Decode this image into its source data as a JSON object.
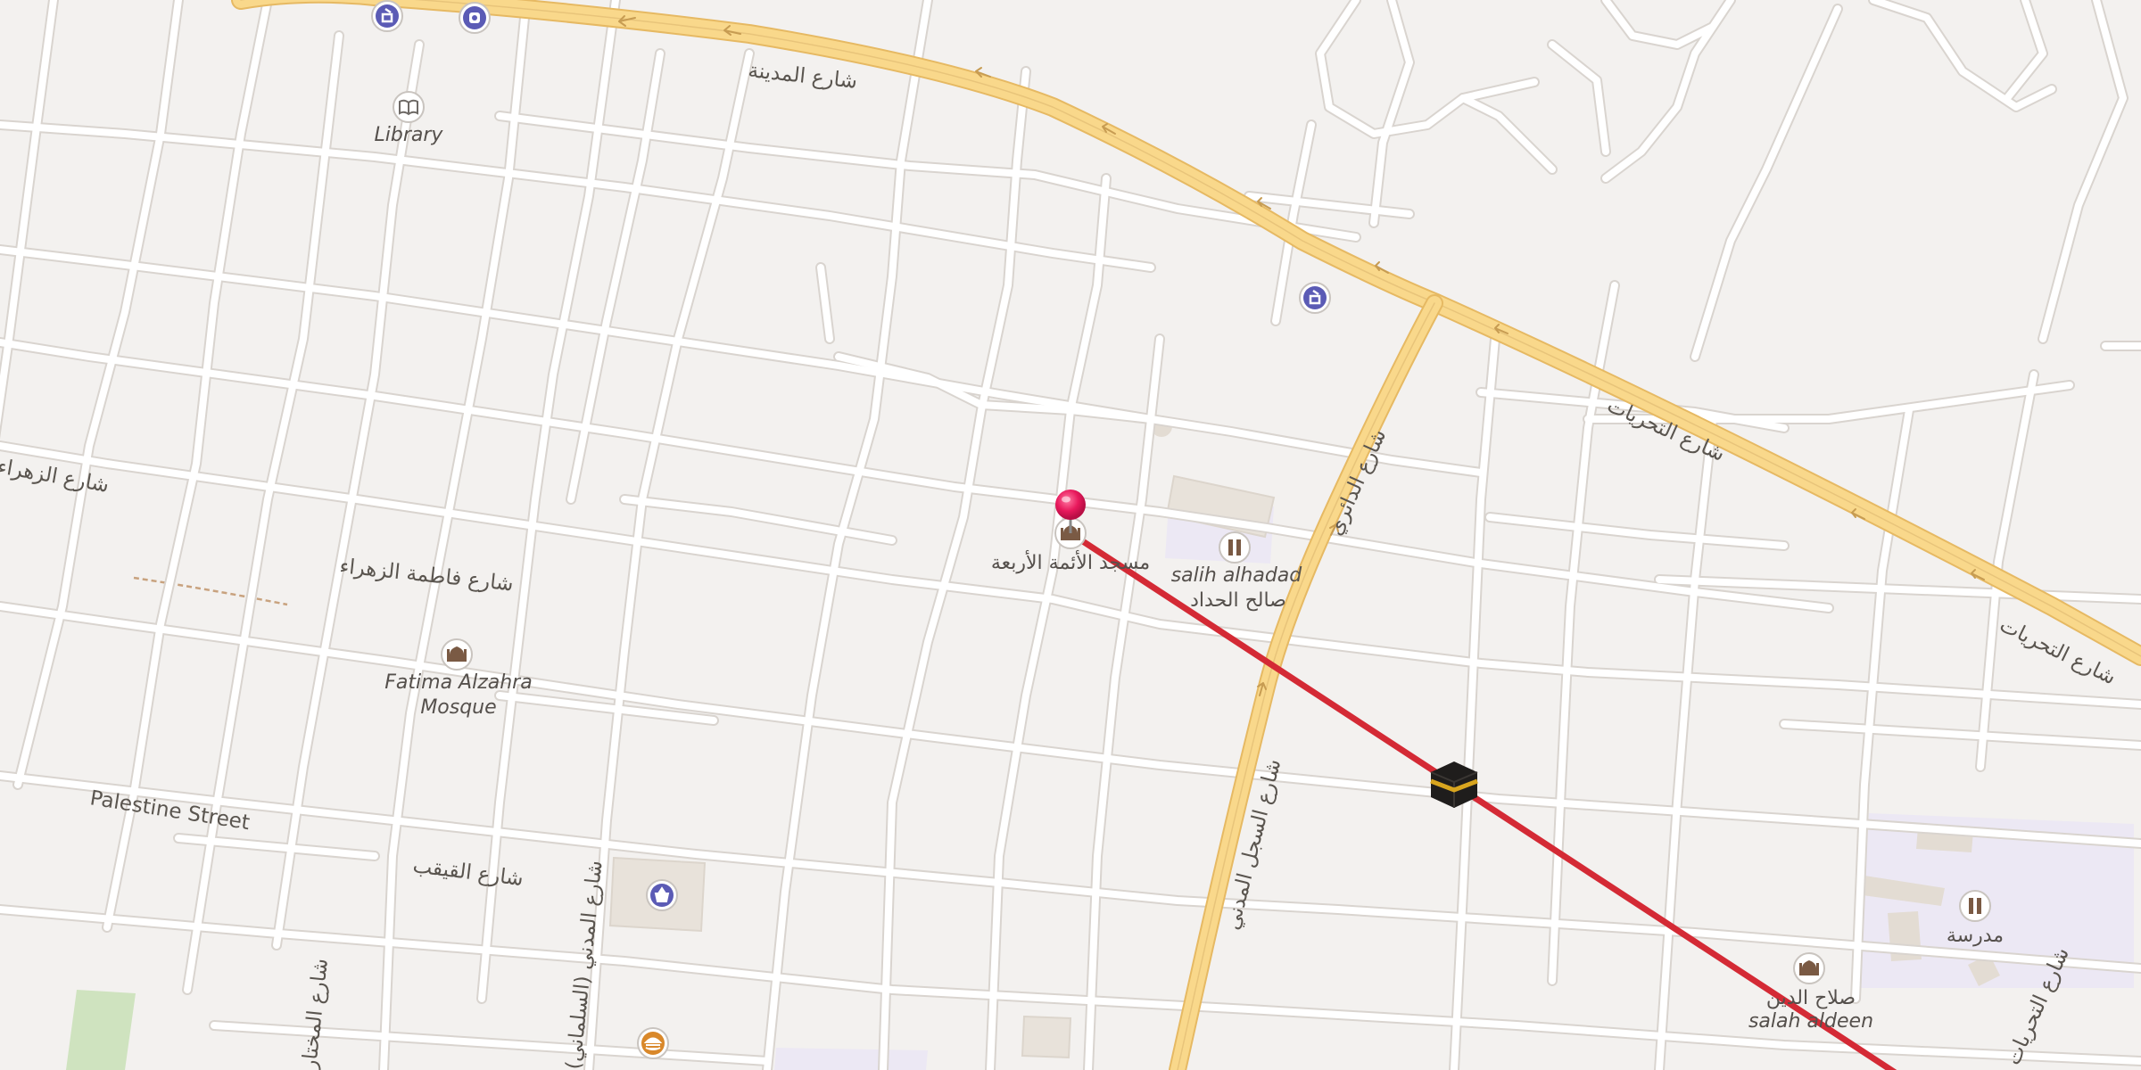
{
  "map": {
    "colors": {
      "background": "#f3f1ef",
      "minor_road": "#ffffff",
      "road_casing": "#d9d4cf",
      "major_road": "#f9d88b",
      "major_casing": "#e6b963",
      "route_line": "#d42a35",
      "pin": "#e8195c",
      "poi_blue": "#5b5bb5",
      "poi_brown": "#7a5a44",
      "campus": "#ece8f4",
      "building": "#e8e2da",
      "park": "#cfe3bf",
      "footpath": "#c8a27e"
    },
    "streets": {
      "al_madina_top": "شارع المدينة",
      "al_madina_north": "شارع الدائري",
      "tahrir_1": "شارع التحريات",
      "tahrir_2": "شارع التحريات",
      "fatima_zahraa": "شارع فاطمة الزهراء",
      "zahraa_left": "شارع الزهراء",
      "palestine": "Palestine Street",
      "qeqab": "شارع القيقب",
      "al_madina_south": "شارع السجل المدني",
      "bottom_left_1": "شارع المختار",
      "bottom_left_2": "شارع المدني (السلماني)",
      "bottom_right": "شارع التحريات"
    },
    "pois": {
      "library": "Library",
      "fatima_mosque_line1": "Fatima Alzahra",
      "fatima_mosque_line2": "Mosque",
      "salih_alhadad_en": "salih alhadad",
      "salih_alhadad_ar": "صالح الحداد",
      "four_imams_mosque": "مسجد الأئمة الأربعة",
      "school": "مدرسة",
      "salah_aldeen_ar": "صلاح الدين",
      "salah_aldeen_en": "salah aldeen"
    },
    "icons": {
      "pharmacy": "pharmacy-icon",
      "dentist": "dentist-icon",
      "library": "library-icon",
      "mosque": "mosque-icon",
      "school": "school-icon",
      "shop": "shop-icon",
      "fastfood": "fast-food-icon",
      "kaaba": "kaaba-icon",
      "pin": "location-pin-icon"
    }
  }
}
